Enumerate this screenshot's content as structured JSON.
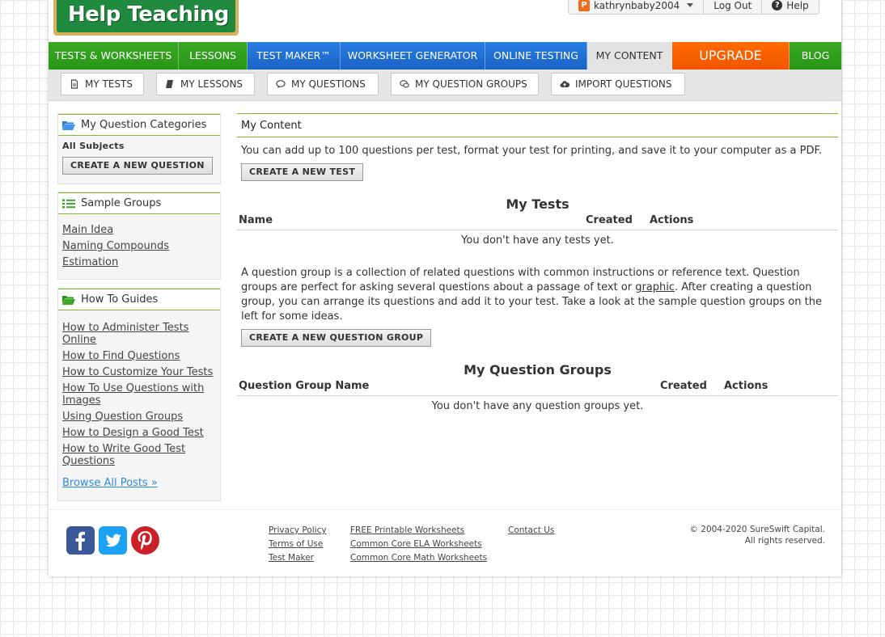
{
  "brand": {
    "logo_text": "Help Teaching"
  },
  "user_menu": {
    "badge": "P",
    "username": "kathrynbaby2004",
    "logout": "Log Out",
    "help": "Help"
  },
  "main_nav": [
    {
      "label": "TESTS & WORKSHEETS"
    },
    {
      "label": "LESSONS"
    },
    {
      "label": "TEST MAKER™"
    },
    {
      "label": "WORKSHEET GENERATOR"
    },
    {
      "label": "ONLINE TESTING"
    },
    {
      "label": "MY CONTENT"
    },
    {
      "label": "UPGRADE"
    },
    {
      "label": "BLOG"
    }
  ],
  "sub_nav": [
    {
      "label": "MY TESTS"
    },
    {
      "label": "MY LESSONS"
    },
    {
      "label": "MY QUESTIONS"
    },
    {
      "label": "MY QUESTION GROUPS"
    },
    {
      "label": "IMPORT QUESTIONS"
    }
  ],
  "sidebar": {
    "categories": {
      "title": "My Question Categories",
      "subject": "All Subjects",
      "button": "CREATE A NEW QUESTION"
    },
    "sample_groups": {
      "title": "Sample Groups",
      "links": [
        "Main Idea",
        "Naming Compounds",
        "Estimation"
      ]
    },
    "guides": {
      "title": "How To Guides",
      "links": [
        "How to Administer Tests Online",
        "How to Find Questions",
        "How to Customize Your Tests",
        "How To Use Questions with Images",
        "Using Question Groups",
        "How to Design a Good Test",
        "How to Write Good Test Questions"
      ],
      "browse": "Browse All Posts »"
    }
  },
  "main": {
    "title": "My Content",
    "tests_intro": "You can add up to 100 questions per test, format your test for printing, and save it to your computer as a PDF.",
    "create_test": "CREATE A NEW TEST",
    "tests_heading": "My Tests",
    "tests_cols": {
      "name": "Name",
      "created": "Created",
      "actions": "Actions"
    },
    "tests_empty": "You don't have any tests yet.",
    "groups_intro_1": "A question group is a collection of related questions with common instructions or reference text. Question groups are perfect for asking several questions about a passage of text or ",
    "groups_intro_link": "graphic",
    "groups_intro_2": ". After creating a question group, you can arrange its questions and add it to your test. Take a look at the sample question groups on the left for some ideas.",
    "create_group": "CREATE A NEW QUESTION GROUP",
    "groups_heading": "My Question Groups",
    "groups_cols": {
      "name": "Question Group Name",
      "created": "Created",
      "actions": "Actions"
    },
    "groups_empty": "You don't have any question groups yet."
  },
  "footer": {
    "col1": [
      "Privacy Policy",
      "Terms of Use",
      "Test Maker"
    ],
    "col2": [
      "FREE Printable Worksheets",
      "Common Core ELA Worksheets",
      "Common Core Math Worksheets"
    ],
    "col3": [
      "Contact Us"
    ],
    "copyright_1": "© 2004-2020 SureSwift Capital.",
    "copyright_2": "All rights reserved."
  },
  "colors": {
    "nav_green": "#279614",
    "nav_blue": "#1a63c4",
    "upgrade_orange": "#f25500",
    "accent_green": "#7dbb2a",
    "facebook": "#3b5998",
    "twitter": "#1da1f2",
    "pinterest": "#cb2027"
  }
}
